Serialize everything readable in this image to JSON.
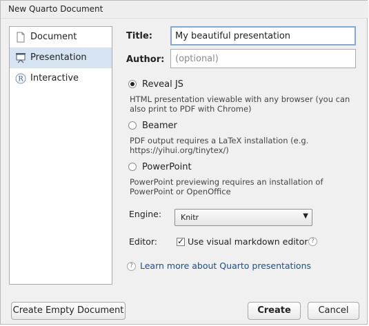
{
  "window": {
    "title": "New Quarto Document"
  },
  "sidebar": {
    "items": [
      {
        "label": "Document",
        "icon": "document-icon",
        "selected": false
      },
      {
        "label": "Presentation",
        "icon": "presentation-icon",
        "selected": true
      },
      {
        "label": "Interactive",
        "icon": "r-interactive-icon",
        "selected": false
      }
    ]
  },
  "form": {
    "title_label": "Title:",
    "title_value": "My beautiful presentation",
    "author_label": "Author:",
    "author_placeholder": "(optional)",
    "formats": [
      {
        "label": "Reveal JS",
        "checked": true,
        "description": "HTML presentation viewable with any browser (you can also print to PDF with Chrome)"
      },
      {
        "label": "Beamer",
        "checked": false,
        "description": "PDF output requires a LaTeX installation (e.g. https://yihui.org/tinytex/)"
      },
      {
        "label": "PowerPoint",
        "checked": false,
        "description": "PowerPoint previewing requires an installation of PowerPoint or OpenOffice"
      }
    ],
    "engine_label": "Engine:",
    "engine_value": "Knitr",
    "editor_label": "Editor:",
    "visual_editor_label": "Use visual markdown editor",
    "visual_editor_checked": true,
    "help_link": "Learn more about Quarto presentations"
  },
  "buttons": {
    "create_empty": "Create Empty Document",
    "create": "Create",
    "cancel": "Cancel"
  }
}
